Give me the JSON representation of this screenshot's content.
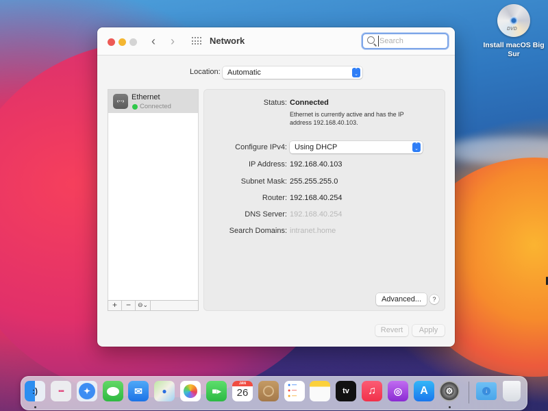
{
  "desktop": {
    "icons": [
      {
        "label": "Install macOS Big Sur",
        "icon": "dvd-disc-icon",
        "badge": "DVD"
      }
    ]
  },
  "window": {
    "title": "Network",
    "search": {
      "placeholder": "Search",
      "value": ""
    },
    "location": {
      "label": "Location:",
      "value": "Automatic"
    },
    "services": [
      {
        "name": "Ethernet",
        "status": "Connected",
        "status_color": "#2fc84a",
        "icon": "ethernet-icon",
        "selected": true
      }
    ],
    "list_toolbar": {
      "add": "+",
      "remove": "−",
      "action": "⊖⌄"
    },
    "detail": {
      "status_label": "Status:",
      "status_value": "Connected",
      "status_description": "Ethernet is currently active and has the IP address 192.168.40.103.",
      "configure_ipv4_label": "Configure IPv4:",
      "configure_ipv4_value": "Using DHCP",
      "ip_address_label": "IP Address:",
      "ip_address_value": "192.168.40.103",
      "subnet_mask_label": "Subnet Mask:",
      "subnet_mask_value": "255.255.255.0",
      "router_label": "Router:",
      "router_value": "192.168.40.254",
      "dns_server_label": "DNS Server:",
      "dns_server_value": "192.168.40.254",
      "search_domains_label": "Search Domains:",
      "search_domains_value": "intranet.home",
      "advanced_label": "Advanced...",
      "help_label": "?"
    },
    "footer": {
      "revert_label": "Revert",
      "apply_label": "Apply"
    }
  },
  "dock": {
    "items": [
      {
        "name": "Finder",
        "icon": "finder-icon",
        "running": true
      },
      {
        "name": "Launchpad",
        "icon": "launchpad-icon"
      },
      {
        "name": "Safari",
        "icon": "safari-icon"
      },
      {
        "name": "Messages",
        "icon": "messages-icon"
      },
      {
        "name": "Mail",
        "icon": "mail-icon"
      },
      {
        "name": "Maps",
        "icon": "maps-icon"
      },
      {
        "name": "Photos",
        "icon": "photos-icon"
      },
      {
        "name": "FaceTime",
        "icon": "facetime-icon"
      },
      {
        "name": "Calendar",
        "icon": "calendar-icon",
        "month": "JAN",
        "day": "26"
      },
      {
        "name": "Contacts",
        "icon": "contacts-icon"
      },
      {
        "name": "Reminders",
        "icon": "reminders-icon"
      },
      {
        "name": "Notes",
        "icon": "notes-icon"
      },
      {
        "name": "TV",
        "icon": "apple-tv-icon",
        "text": "tv"
      },
      {
        "name": "Music",
        "icon": "music-icon"
      },
      {
        "name": "Podcasts",
        "icon": "podcasts-icon"
      },
      {
        "name": "App Store",
        "icon": "app-store-icon"
      },
      {
        "name": "System Preferences",
        "icon": "system-preferences-icon",
        "running": true
      },
      {
        "name": "Downloads",
        "icon": "downloads-folder-icon"
      },
      {
        "name": "Trash",
        "icon": "trash-icon"
      }
    ]
  }
}
